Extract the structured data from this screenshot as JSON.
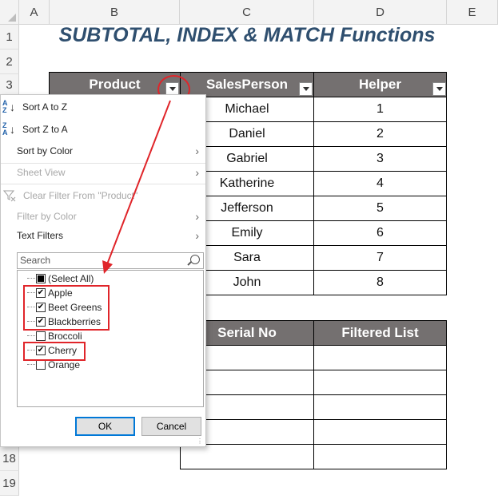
{
  "columns": [
    "A",
    "B",
    "C",
    "D",
    "E"
  ],
  "rows": [
    "1",
    "2",
    "3",
    "18",
    "19"
  ],
  "title": "SUBTOTAL, INDEX & MATCH Functions",
  "table1": {
    "headers": [
      "Product",
      "SalesPerson",
      "Helper"
    ],
    "salespersons": [
      "Michael",
      "Daniel",
      "Gabriel",
      "Katherine",
      "Jefferson",
      "Emily",
      "Sara",
      "John"
    ],
    "helpers": [
      "1",
      "2",
      "3",
      "4",
      "5",
      "6",
      "7",
      "8"
    ]
  },
  "table2": {
    "headers": [
      "Serial No",
      "Filtered List"
    ]
  },
  "dropdown": {
    "sort_az": "Sort A to Z",
    "sort_za": "Sort Z to A",
    "sort_by_color": "Sort by Color",
    "sheet_view": "Sheet View",
    "clear_filter": "Clear Filter From \"Product\"",
    "filter_by_color": "Filter by Color",
    "text_filters": "Text Filters",
    "search_placeholder": "Search",
    "items": [
      {
        "label": "(Select All)",
        "state": "partial"
      },
      {
        "label": "Apple",
        "state": "checked"
      },
      {
        "label": "Beet Greens",
        "state": "checked"
      },
      {
        "label": "Blackberries",
        "state": "checked"
      },
      {
        "label": "Broccoli",
        "state": "unchecked"
      },
      {
        "label": "Cherry",
        "state": "checked"
      },
      {
        "label": "Orange",
        "state": "unchecked"
      }
    ],
    "ok": "OK",
    "cancel": "Cancel"
  },
  "colors": {
    "header_fill": "#747070",
    "title": "#2f4f6f",
    "annotation": "#e0252a"
  }
}
